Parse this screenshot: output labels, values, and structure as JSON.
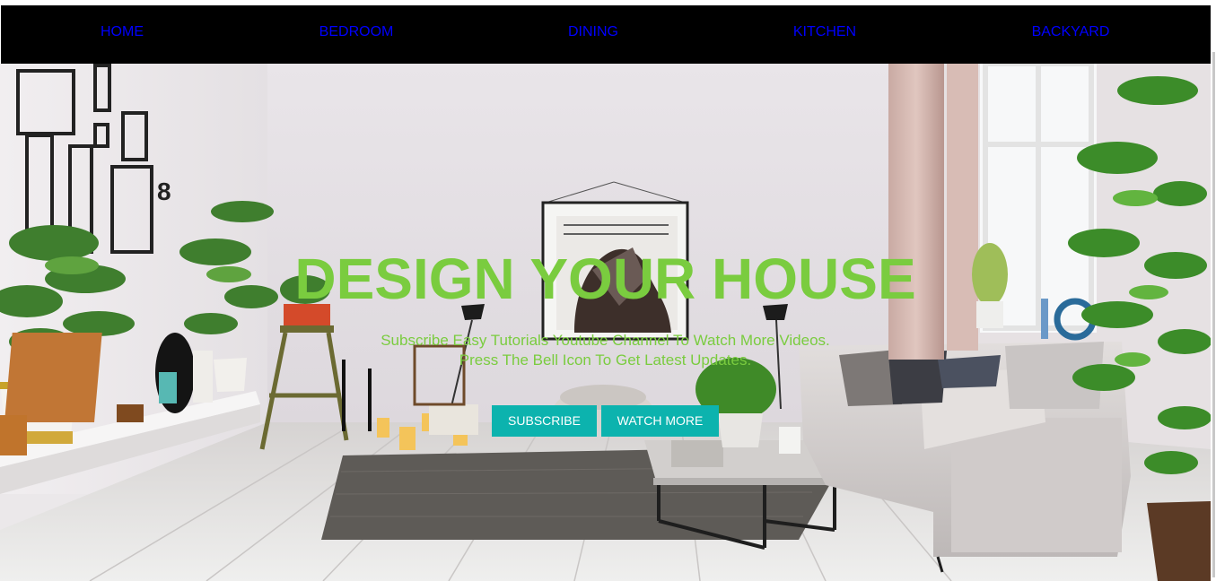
{
  "nav": {
    "items": [
      {
        "label": "HOME"
      },
      {
        "label": "BEDROOM"
      },
      {
        "label": "DINING"
      },
      {
        "label": "KITCHEN"
      },
      {
        "label": "BACKYARD"
      }
    ]
  },
  "hero": {
    "title": "DESIGN YOUR HOUSE",
    "subtitle_line1": "Subscribe Easy Tutorials Youtube Channel To Watch More Videos.",
    "subtitle_line2": "Press The Bell Icon To Get Latest Updates.",
    "buttons": {
      "subscribe": "SUBSCRIBE",
      "watch_more": "WATCH MORE"
    },
    "image": "living-room-interior-photo"
  },
  "colors": {
    "nav_background": "#000000",
    "nav_link": "#0000ff",
    "hero_text": "#7acc3f",
    "button_background": "#0cb3ae",
    "button_text": "#ffffff"
  }
}
